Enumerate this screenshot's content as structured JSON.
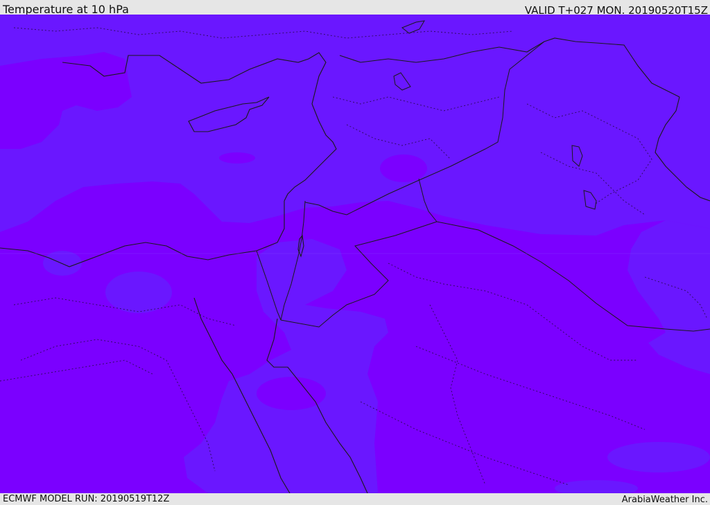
{
  "header": {
    "title": "Temperature at 10 hPa",
    "valid_label": "VALID T+027 MON. 20190520T15Z"
  },
  "footer": {
    "model_run": "ECMWF MODEL RUN: 20190519T12Z",
    "brand": "ArabiaWeather Inc."
  },
  "colors": {
    "bar_background": "#e6e6e6",
    "temperature_band_cool": "#6a17ff",
    "temperature_band_warm": "#7b00ff",
    "border_line": "#1a1a1a"
  }
}
